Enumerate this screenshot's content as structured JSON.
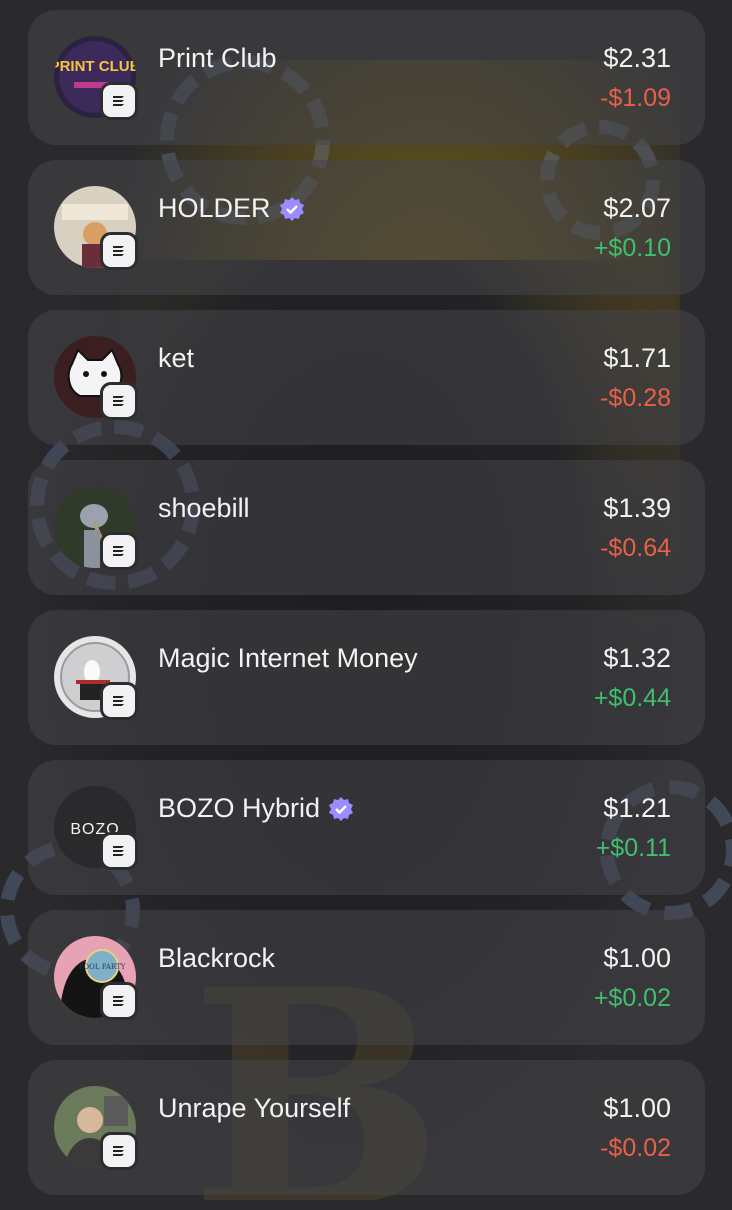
{
  "colors": {
    "negative": "#e8604a",
    "positive": "#3fbf6f",
    "verified": "#9b8cff"
  },
  "tokens": [
    {
      "name": "Print Club",
      "verified": false,
      "price": "$2.31",
      "change": "-$1.09",
      "direction": "down",
      "chain_icon": "solana-icon",
      "avatar_text": "PRINT CLUB"
    },
    {
      "name": "HOLDER",
      "verified": true,
      "price": "$2.07",
      "change": "+$0.10",
      "direction": "up",
      "chain_icon": "solana-icon",
      "avatar_text": ""
    },
    {
      "name": "ket",
      "verified": false,
      "price": "$1.71",
      "change": "-$0.28",
      "direction": "down",
      "chain_icon": "solana-icon",
      "avatar_text": ""
    },
    {
      "name": "shoebill",
      "verified": false,
      "price": "$1.39",
      "change": "-$0.64",
      "direction": "down",
      "chain_icon": "solana-icon",
      "avatar_text": ""
    },
    {
      "name": "Magic Internet Money",
      "verified": false,
      "price": "$1.32",
      "change": "+$0.44",
      "direction": "up",
      "chain_icon": "solana-icon",
      "avatar_text": ""
    },
    {
      "name": "BOZO Hybrid",
      "verified": true,
      "price": "$1.21",
      "change": "+$0.11",
      "direction": "up",
      "chain_icon": "solana-icon",
      "avatar_text": "BOZO"
    },
    {
      "name": "Blackrock",
      "verified": false,
      "price": "$1.00",
      "change": "+$0.02",
      "direction": "up",
      "chain_icon": "solana-icon",
      "avatar_text": "POOL PARTY"
    },
    {
      "name": "Unrape Yourself",
      "verified": false,
      "price": "$1.00",
      "change": "-$0.02",
      "direction": "down",
      "chain_icon": "solana-icon",
      "avatar_text": ""
    }
  ]
}
